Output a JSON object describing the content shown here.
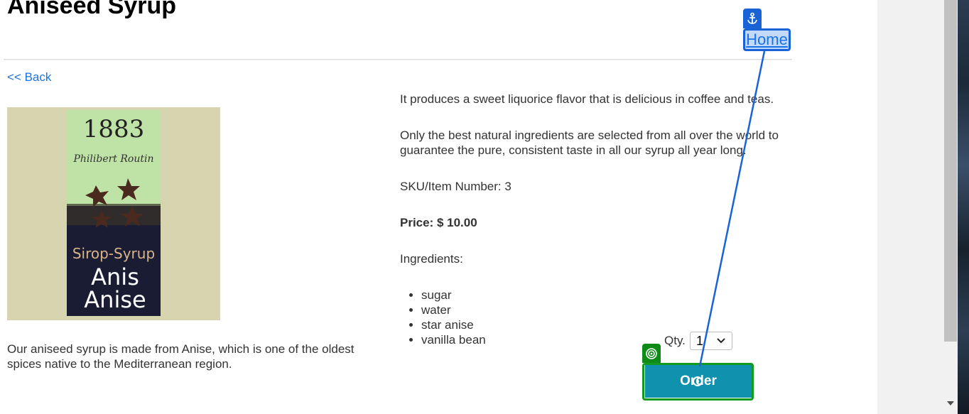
{
  "page": {
    "title": "Aniseed Syrup",
    "back_link": "<< Back",
    "home_link": "Home"
  },
  "product": {
    "image": {
      "icon": "aniseed-syrup-product-photo",
      "label_top": "1883",
      "label_script": "Philibert Routin",
      "label_type": "Sirop-Syrup",
      "label_name_fr": "Anis",
      "label_name_en": "Anise"
    },
    "short_description": "Our aniseed syrup is made from Anise, which is one of the oldest spices native to the Mediterranean region.",
    "paragraphs": [
      "It produces a sweet liquorice flavor that is delicious in coffee and teas.",
      "Only the best natural ingredients are selected from all over the world to guarantee the pure, consistent taste in all our syrup all year long."
    ],
    "sku_line": "SKU/Item Number: 3",
    "price_line": "Price: $ 10.00",
    "ingredients_label": "Ingredients:",
    "ingredients": [
      "sugar",
      "water",
      "star anise",
      "vanilla bean"
    ]
  },
  "order": {
    "qty_label": "Qty.",
    "qty_value": "1",
    "button_label": "Order"
  },
  "annotations": {
    "home_badge_icon": "anchor-icon",
    "order_badge_icon": "target-icon",
    "home_color": "#1a63d6",
    "order_color": "#119a1e"
  },
  "theme": {
    "accent": "#1091ad",
    "link": "#1a73e8",
    "text": "#333333"
  }
}
